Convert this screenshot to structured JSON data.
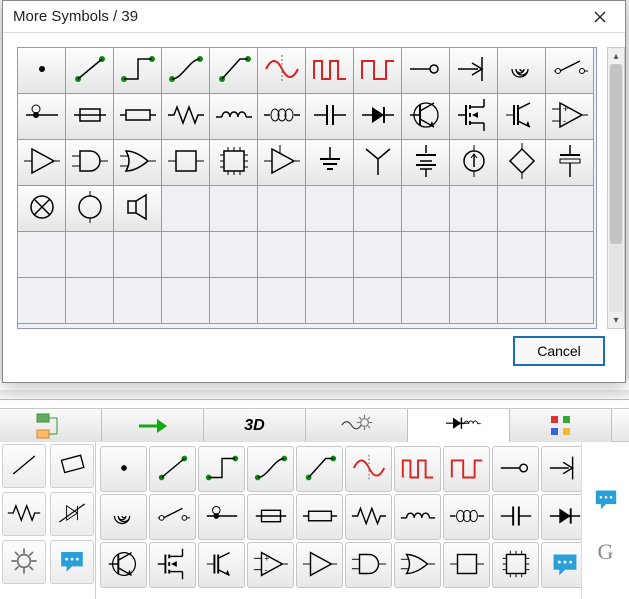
{
  "dialog": {
    "title": "More Symbols / 39",
    "cancel_label": "Cancel",
    "grid_cols": 12,
    "grid_rows": 6,
    "total_cells": 72,
    "symbols": [
      {
        "i": 0,
        "id": "dot",
        "name": "dot-point",
        "color": "#000"
      },
      {
        "i": 1,
        "id": "line-seg",
        "name": "line-segment",
        "color": "#0a8a0a"
      },
      {
        "i": 2,
        "id": "step-up",
        "name": "step-up-pulse",
        "color": "#0a8a0a"
      },
      {
        "i": 3,
        "id": "s-curve",
        "name": "s-curve",
        "color": "#0a8a0a"
      },
      {
        "i": 4,
        "id": "rising",
        "name": "rising-edge",
        "color": "#0a8a0a"
      },
      {
        "i": 5,
        "id": "sine",
        "name": "sine-wave",
        "color": "#d22"
      },
      {
        "i": 6,
        "id": "sq-narrow",
        "name": "square-wave-narrow",
        "color": "#d22"
      },
      {
        "i": 7,
        "id": "sq-wide",
        "name": "square-wave-wide",
        "color": "#d22"
      },
      {
        "i": 8,
        "id": "term-open",
        "name": "terminal-open",
        "color": "#000"
      },
      {
        "i": 9,
        "id": "arrow-node",
        "name": "arrow-into-node",
        "color": "#000"
      },
      {
        "i": 10,
        "id": "spiral",
        "name": "spiral",
        "color": "#000"
      },
      {
        "i": 11,
        "id": "switch-open",
        "name": "switch-open",
        "color": "#000"
      },
      {
        "i": 12,
        "id": "conn-dot",
        "name": "connector-dot-line",
        "color": "#000"
      },
      {
        "i": 13,
        "id": "fuse",
        "name": "fuse",
        "color": "#000"
      },
      {
        "i": 14,
        "id": "res-box",
        "name": "resistor-box",
        "color": "#000"
      },
      {
        "i": 15,
        "id": "res-zig",
        "name": "resistor-zigzag",
        "color": "#000"
      },
      {
        "i": 16,
        "id": "coil-arc",
        "name": "inductor-arcs",
        "color": "#000"
      },
      {
        "i": 17,
        "id": "coil-loop",
        "name": "inductor-loops",
        "color": "#000"
      },
      {
        "i": 18,
        "id": "cap",
        "name": "capacitor",
        "color": "#000"
      },
      {
        "i": 19,
        "id": "diode",
        "name": "diode",
        "color": "#000"
      },
      {
        "i": 20,
        "id": "bjt",
        "name": "transistor-bjt",
        "color": "#000"
      },
      {
        "i": 21,
        "id": "mosfet",
        "name": "mosfet",
        "color": "#000"
      },
      {
        "i": 22,
        "id": "igbt",
        "name": "igbt",
        "color": "#000"
      },
      {
        "i": 23,
        "id": "opamp",
        "name": "op-amp",
        "color": "#000"
      },
      {
        "i": 24,
        "id": "buffer",
        "name": "buffer-gate",
        "color": "#000"
      },
      {
        "i": 25,
        "id": "and",
        "name": "and-gate",
        "color": "#000"
      },
      {
        "i": 26,
        "id": "or",
        "name": "or-gate",
        "color": "#000"
      },
      {
        "i": 27,
        "id": "block",
        "name": "block-box",
        "color": "#000"
      },
      {
        "i": 28,
        "id": "ic",
        "name": "ic-chip",
        "color": "#000"
      },
      {
        "i": 29,
        "id": "amp-tri",
        "name": "amplifier-triangle",
        "color": "#000"
      },
      {
        "i": 30,
        "id": "gnd",
        "name": "ground",
        "color": "#000"
      },
      {
        "i": 31,
        "id": "antenna",
        "name": "antenna",
        "color": "#000"
      },
      {
        "i": 32,
        "id": "battery",
        "name": "battery",
        "color": "#000"
      },
      {
        "i": 33,
        "id": "source-i",
        "name": "current-source",
        "color": "#000"
      },
      {
        "i": 34,
        "id": "diamond",
        "name": "dependent-source",
        "color": "#000"
      },
      {
        "i": 35,
        "id": "cap-pol",
        "name": "capacitor-polarized",
        "color": "#000"
      },
      {
        "i": 36,
        "id": "lamp",
        "name": "lamp-x-circle",
        "color": "#000"
      },
      {
        "i": 37,
        "id": "motor",
        "name": "motor-circle",
        "color": "#000"
      },
      {
        "i": 38,
        "id": "speaker",
        "name": "speaker",
        "color": "#000"
      }
    ]
  },
  "tabs": [
    {
      "id": "tree",
      "name": "tab-tree",
      "active": false
    },
    {
      "id": "arrow",
      "name": "tab-arrow",
      "active": false
    },
    {
      "id": "3d",
      "name": "tab-3d",
      "label": "3D",
      "active": false
    },
    {
      "id": "gear",
      "name": "tab-gear",
      "active": false
    },
    {
      "id": "circuit",
      "name": "tab-circuit",
      "active": true
    },
    {
      "id": "apps",
      "name": "tab-apps",
      "active": false
    }
  ],
  "side_palette": [
    {
      "id": "line",
      "name": "tool-line"
    },
    {
      "id": "rect",
      "name": "tool-rect"
    },
    {
      "id": "res-zig",
      "name": "tool-resistor"
    },
    {
      "id": "diode-sl",
      "name": "tool-diode-slash"
    },
    {
      "id": "gear",
      "name": "tool-gear"
    },
    {
      "id": "chat",
      "name": "tool-chat"
    }
  ],
  "main_palette": {
    "rows": 3,
    "cols": 10,
    "symbols": [
      {
        "r": 0,
        "c": 0,
        "id": "dot"
      },
      {
        "r": 0,
        "c": 1,
        "id": "line-seg"
      },
      {
        "r": 0,
        "c": 2,
        "id": "step-up"
      },
      {
        "r": 0,
        "c": 3,
        "id": "s-curve"
      },
      {
        "r": 0,
        "c": 4,
        "id": "rising"
      },
      {
        "r": 0,
        "c": 5,
        "id": "sine"
      },
      {
        "r": 0,
        "c": 6,
        "id": "sq-narrow"
      },
      {
        "r": 0,
        "c": 7,
        "id": "sq-wide"
      },
      {
        "r": 0,
        "c": 8,
        "id": "term-open"
      },
      {
        "r": 0,
        "c": 9,
        "id": "arrow-node"
      },
      {
        "r": 1,
        "c": 0,
        "id": "spiral"
      },
      {
        "r": 1,
        "c": 1,
        "id": "switch-open"
      },
      {
        "r": 1,
        "c": 2,
        "id": "conn-dot"
      },
      {
        "r": 1,
        "c": 3,
        "id": "fuse"
      },
      {
        "r": 1,
        "c": 4,
        "id": "res-box"
      },
      {
        "r": 1,
        "c": 5,
        "id": "res-zig"
      },
      {
        "r": 1,
        "c": 6,
        "id": "coil-arc"
      },
      {
        "r": 1,
        "c": 7,
        "id": "coil-loop"
      },
      {
        "r": 1,
        "c": 8,
        "id": "cap"
      },
      {
        "r": 1,
        "c": 9,
        "id": "diode"
      },
      {
        "r": 2,
        "c": 0,
        "id": "bjt"
      },
      {
        "r": 2,
        "c": 1,
        "id": "mosfet"
      },
      {
        "r": 2,
        "c": 2,
        "id": "igbt"
      },
      {
        "r": 2,
        "c": 3,
        "id": "opamp"
      },
      {
        "r": 2,
        "c": 4,
        "id": "buffer"
      },
      {
        "r": 2,
        "c": 5,
        "id": "and"
      },
      {
        "r": 2,
        "c": 6,
        "id": "or"
      },
      {
        "r": 2,
        "c": 7,
        "id": "block"
      },
      {
        "r": 2,
        "c": 8,
        "id": "ic"
      },
      {
        "r": 2,
        "c": 9,
        "id": "chat"
      }
    ]
  },
  "right_strip": [
    {
      "id": "chat",
      "name": "right-chat",
      "color": "#2aa0d8"
    },
    {
      "id": "G",
      "name": "right-letter",
      "label": "G",
      "color": "#888"
    }
  ]
}
